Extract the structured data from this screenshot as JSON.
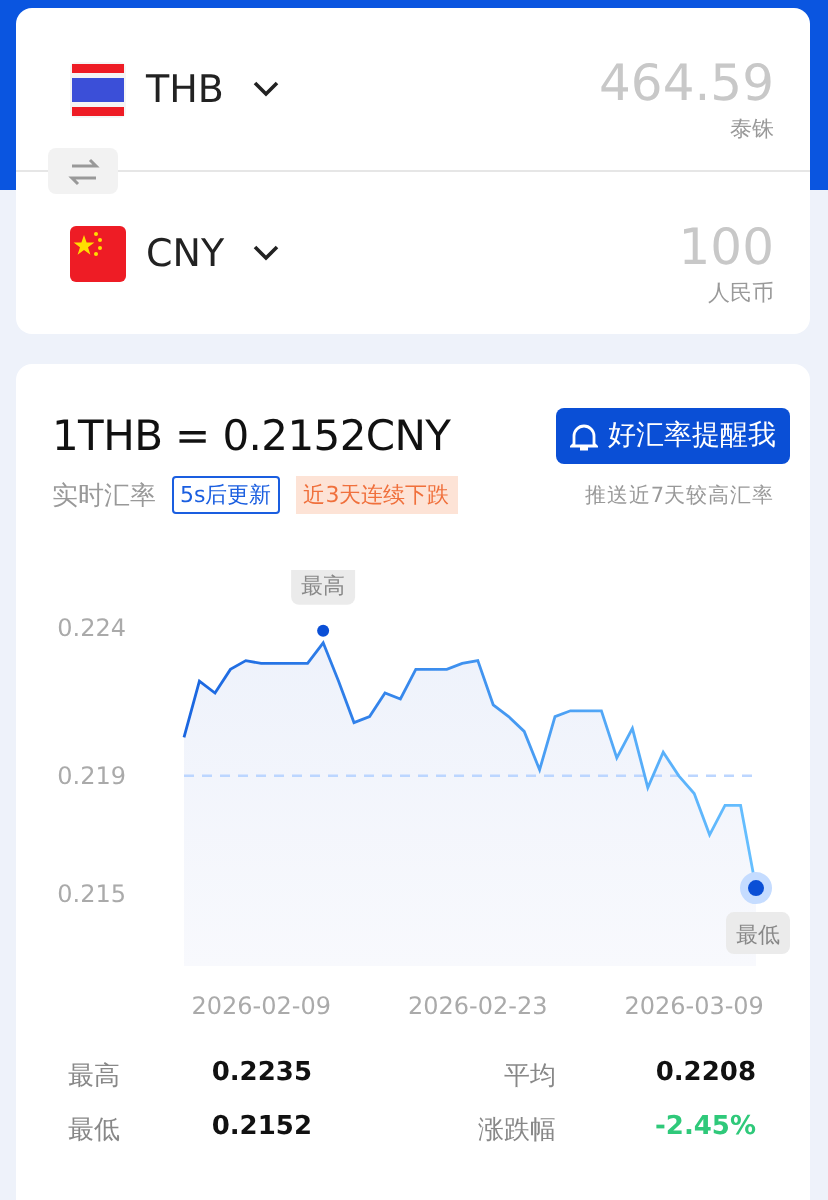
{
  "converter": {
    "rows": [
      {
        "code": "THB",
        "kind": "thailand",
        "amount": "464.59",
        "currency_name": "泰铢"
      },
      {
        "code": "CNY",
        "kind": "china",
        "amount": "100",
        "currency_name": "人民币"
      }
    ]
  },
  "rate": {
    "title": "1THB = 0.2152CNY",
    "label": "实时汇率",
    "refresh_badge": "5s后更新",
    "trend_badge": "近3天连续下跌",
    "alert_button": "好汇率提醒我",
    "alert_hint": "推送近7天较高汇率"
  },
  "chart_data": {
    "type": "area",
    "categories": [
      null,
      null,
      null,
      null,
      null,
      "2026-02-09",
      null,
      null,
      null,
      null,
      null,
      null,
      null,
      null,
      null,
      null,
      null,
      null,
      null,
      "2026-02-23",
      null,
      null,
      null,
      null,
      null,
      null,
      null,
      null,
      null,
      null,
      null,
      null,
      null,
      "2026-03-09",
      null,
      null,
      null,
      null
    ],
    "series": [
      {
        "color": "#1a66e0",
        "values": [
          0.2203,
          0.2222,
          0.2218,
          0.2226,
          0.2229,
          0.2228,
          0.2228,
          0.2228,
          0.2228,
          0.2235,
          0.2222,
          0.2208,
          0.221,
          0.2218,
          0.2216,
          0.2226,
          0.2226,
          0.2226,
          0.2228,
          0.2229,
          0.2214,
          0.221,
          0.2205,
          0.2192,
          0.221,
          0.2212,
          0.2212,
          0.2212,
          0.2196,
          0.2206,
          0.2186,
          0.2198,
          0.219,
          0.2184,
          0.217,
          0.218,
          0.218,
          0.2152
        ]
      }
    ],
    "yticks": [
      {
        "value": 0.224,
        "label": "0.224"
      },
      {
        "value": 0.219,
        "label": "0.219"
      },
      {
        "value": 0.215,
        "label": "0.215"
      }
    ],
    "ylim": [
      0.215,
      0.224
    ],
    "ref_lines": [
      {
        "axis": "y",
        "value": 0.219
      }
    ],
    "annotations": [
      {
        "text": "最高",
        "y": 0.2235
      },
      {
        "text": "最低",
        "y": 0.2152
      }
    ]
  },
  "stats": [
    {
      "label": "最高",
      "value": "0.2235",
      "color": "#111111"
    },
    {
      "label": "平均",
      "value": "0.2208",
      "color": "#111111"
    },
    {
      "label": "最低",
      "value": "0.2152",
      "color": "#111111"
    },
    {
      "label": "涨跌幅",
      "value": "-2.45%",
      "color": "#2fc97a"
    }
  ]
}
